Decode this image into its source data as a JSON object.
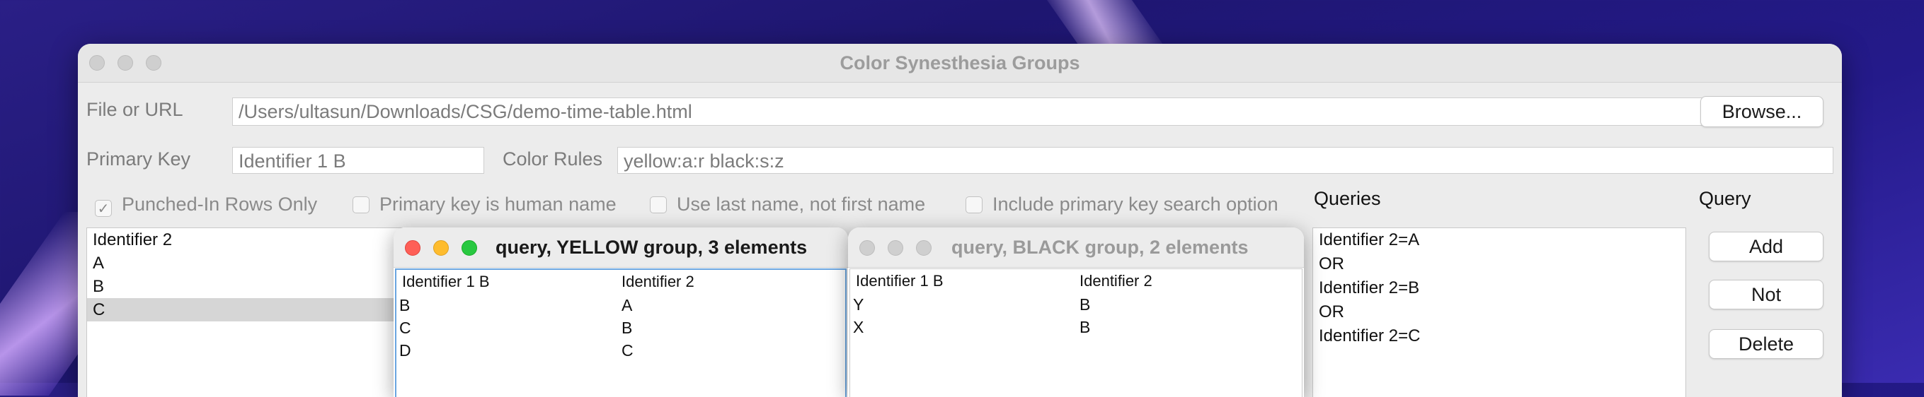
{
  "main_window": {
    "title": "Color Synesthesia Groups",
    "file_label": "File or URL",
    "file_value": "/Users/ultasun/Downloads/CSG/demo-time-table.html",
    "browse_label": "Browse...",
    "primary_key_label": "Primary Key",
    "primary_key_value": "Identifier 1 B",
    "color_rules_label": "Color Rules",
    "color_rules_value": "yellow:a:r black:s:z",
    "checkboxes": [
      {
        "label": "Punched-In Rows Only",
        "checked": true
      },
      {
        "label": "Primary key is human name",
        "checked": false
      },
      {
        "label": "Use last name, not first name",
        "checked": false
      },
      {
        "label": "Include primary key search option",
        "checked": false
      }
    ],
    "queries_label": "Queries",
    "query_label": "Query",
    "left_list": {
      "header": "Identifier 2",
      "items": [
        "A",
        "B",
        "C"
      ],
      "selected": "C"
    },
    "queries_list": [
      "Identifier 2=A",
      "OR",
      "Identifier 2=B",
      "OR",
      "Identifier 2=C"
    ],
    "buttons": {
      "add": "Add",
      "not": "Not",
      "delete": "Delete"
    }
  },
  "yellow_window": {
    "title": "query, YELLOW group, 3 elements",
    "columns": [
      "Identifier 1 B",
      "Identifier 2"
    ],
    "rows": [
      [
        "B",
        "A"
      ],
      [
        "C",
        "B"
      ],
      [
        "D",
        "C"
      ]
    ]
  },
  "black_window": {
    "title": "query, BLACK group, 2 elements",
    "columns": [
      "Identifier 1 B",
      "Identifier 2"
    ],
    "rows": [
      [
        "Y",
        "B"
      ],
      [
        "X",
        "B"
      ]
    ]
  },
  "colors": {
    "close": "#fe5f57",
    "minimize": "#febc2e",
    "zoom": "#28c840",
    "inactive_light": "#cfcfcf",
    "selection": "#d6d6d6"
  }
}
